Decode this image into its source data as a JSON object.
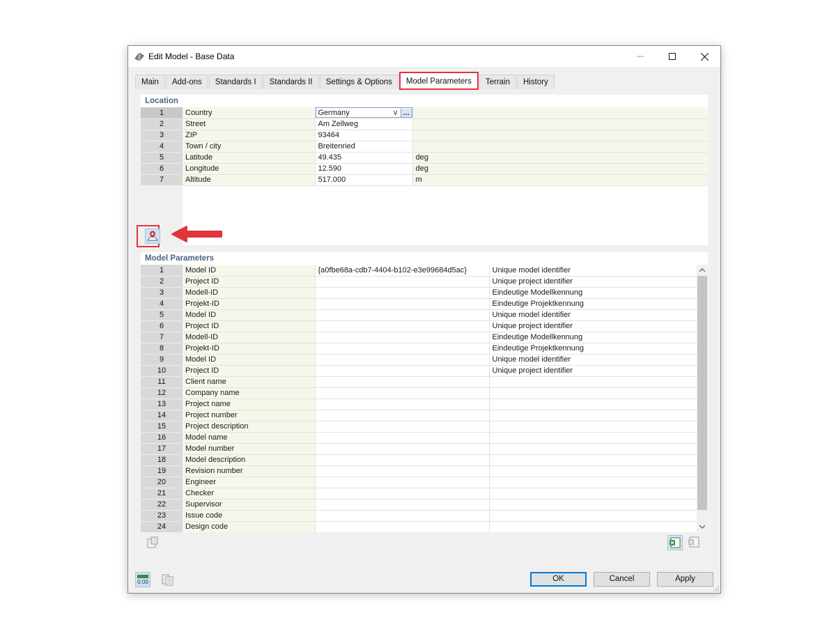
{
  "window": {
    "title": "Edit Model - Base Data"
  },
  "tabs": [
    {
      "label": "Main"
    },
    {
      "label": "Add-ons"
    },
    {
      "label": "Standards I"
    },
    {
      "label": "Standards II"
    },
    {
      "label": "Settings & Options"
    },
    {
      "label": "Model Parameters",
      "active": true
    },
    {
      "label": "Terrain"
    },
    {
      "label": "History"
    }
  ],
  "location": {
    "title": "Location",
    "rows": [
      {
        "num": "1",
        "label": "Country",
        "value": "Germany",
        "unit": ""
      },
      {
        "num": "2",
        "label": "Street",
        "value": "Am Zellweg",
        "unit": ""
      },
      {
        "num": "3",
        "label": "ZIP",
        "value": "93464",
        "unit": ""
      },
      {
        "num": "4",
        "label": "Town / city",
        "value": "Breitenried",
        "unit": ""
      },
      {
        "num": "5",
        "label": "Latitude",
        "value": "49.435",
        "unit": "deg"
      },
      {
        "num": "6",
        "label": "Longitude",
        "value": "12.590",
        "unit": "deg"
      },
      {
        "num": "7",
        "label": "Altitude",
        "value": "517.000",
        "unit": "m"
      }
    ],
    "country_dots": "..."
  },
  "model_parameters": {
    "title": "Model Parameters",
    "rows": [
      {
        "num": "1",
        "name": "Model ID",
        "value": "{a0fbe68a-cdb7-4404-b102-e3e99684d5ac}",
        "desc": "Unique model identifier"
      },
      {
        "num": "2",
        "name": "Project ID",
        "value": "",
        "desc": "Unique project identifier"
      },
      {
        "num": "3",
        "name": "Modell-ID",
        "value": "",
        "desc": "Eindeutige Modellkennung"
      },
      {
        "num": "4",
        "name": "Projekt-ID",
        "value": "",
        "desc": "Eindeutige Projektkennung"
      },
      {
        "num": "5",
        "name": "Model ID",
        "value": "",
        "desc": "Unique model identifier"
      },
      {
        "num": "6",
        "name": "Project ID",
        "value": "",
        "desc": "Unique project identifier"
      },
      {
        "num": "7",
        "name": "Modell-ID",
        "value": "",
        "desc": "Eindeutige Modellkennung"
      },
      {
        "num": "8",
        "name": "Projekt-ID",
        "value": "",
        "desc": "Eindeutige Projektkennung"
      },
      {
        "num": "9",
        "name": "Model ID",
        "value": "",
        "desc": "Unique model identifier"
      },
      {
        "num": "10",
        "name": "Project ID",
        "value": "",
        "desc": "Unique project identifier"
      },
      {
        "num": "11",
        "name": "Client name",
        "value": "",
        "desc": ""
      },
      {
        "num": "12",
        "name": "Company name",
        "value": "",
        "desc": ""
      },
      {
        "num": "13",
        "name": "Project name",
        "value": "",
        "desc": ""
      },
      {
        "num": "14",
        "name": "Project number",
        "value": "",
        "desc": ""
      },
      {
        "num": "15",
        "name": "Project description",
        "value": "",
        "desc": ""
      },
      {
        "num": "16",
        "name": "Model name",
        "value": "",
        "desc": ""
      },
      {
        "num": "17",
        "name": "Model number",
        "value": "",
        "desc": ""
      },
      {
        "num": "18",
        "name": "Model description",
        "value": "",
        "desc": ""
      },
      {
        "num": "19",
        "name": "Revision number",
        "value": "",
        "desc": ""
      },
      {
        "num": "20",
        "name": "Engineer",
        "value": "",
        "desc": ""
      },
      {
        "num": "21",
        "name": "Checker",
        "value": "",
        "desc": ""
      },
      {
        "num": "22",
        "name": "Supervisor",
        "value": "",
        "desc": ""
      },
      {
        "num": "23",
        "name": "Issue code",
        "value": "",
        "desc": ""
      },
      {
        "num": "24",
        "name": "Design code",
        "value": "",
        "desc": ""
      }
    ]
  },
  "footer": {
    "units_icon_text": "0.00",
    "ok_label": "OK",
    "cancel_label": "Cancel",
    "apply_label": "Apply"
  },
  "colors": {
    "highlight": "#e0353b",
    "accent": "#0078d7",
    "section_title": "#4b6486"
  },
  "icons": [
    "app-icon",
    "minimize-icon",
    "maximize-icon",
    "close-icon",
    "map-location-icon",
    "red-arrow-icon",
    "scroll-up-icon",
    "scroll-down-icon",
    "import-icon",
    "excel-export-icon",
    "excel-import-icon",
    "units-icon",
    "library-icon"
  ]
}
